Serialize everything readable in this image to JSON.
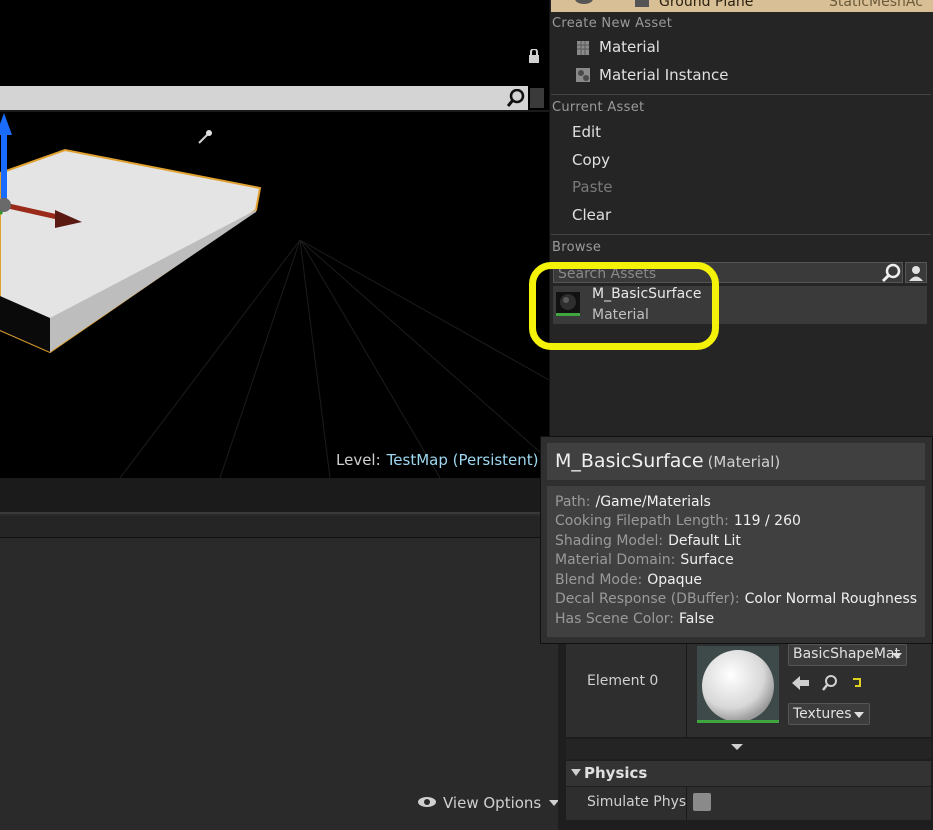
{
  "viewport": {
    "level_prefix": "Level:",
    "level_name": "TestMap (Persistent)"
  },
  "outliner_top_row": {
    "name": "Ground Plane",
    "type": "StaticMeshAc"
  },
  "menu": {
    "create_header": "Create New Asset",
    "create_items": [
      "Material",
      "Material Instance"
    ],
    "current_header": "Current Asset",
    "current_items": {
      "edit": "Edit",
      "copy": "Copy",
      "paste": "Paste",
      "clear": "Clear"
    },
    "browse_header": "Browse",
    "search_placeholder": "Search Assets",
    "asset": {
      "name": "M_BasicSurface",
      "type": "Material"
    }
  },
  "tooltip": {
    "title": "M_BasicSurface",
    "kind": "(Material)",
    "rows": [
      {
        "key": "Path:",
        "value": "/Game/Materials"
      },
      {
        "key": "Cooking Filepath Length:",
        "value": "119 / 260"
      },
      {
        "key": "Shading Model:",
        "value": "Default Lit"
      },
      {
        "key": "Material Domain:",
        "value": "Surface"
      },
      {
        "key": "Blend Mode:",
        "value": "Opaque"
      },
      {
        "key": "Decal Response (DBuffer):",
        "value": "Color Normal Roughness"
      },
      {
        "key": "Has Scene Color:",
        "value": "False"
      }
    ]
  },
  "details": {
    "element_label": "Element 0",
    "material_combo": "BasicShapeMat",
    "textures_button": "Textures",
    "physics_header": "Physics",
    "simulate_label": "Simulate Physi",
    "simulate_checked": false
  },
  "bottom_left": {
    "view_options": "View Options"
  },
  "colors": {
    "highlight": "#f5f20a",
    "selection_outline": "#e0a030",
    "material_green": "#3fa53f",
    "level_name": "#9ed8f0"
  }
}
